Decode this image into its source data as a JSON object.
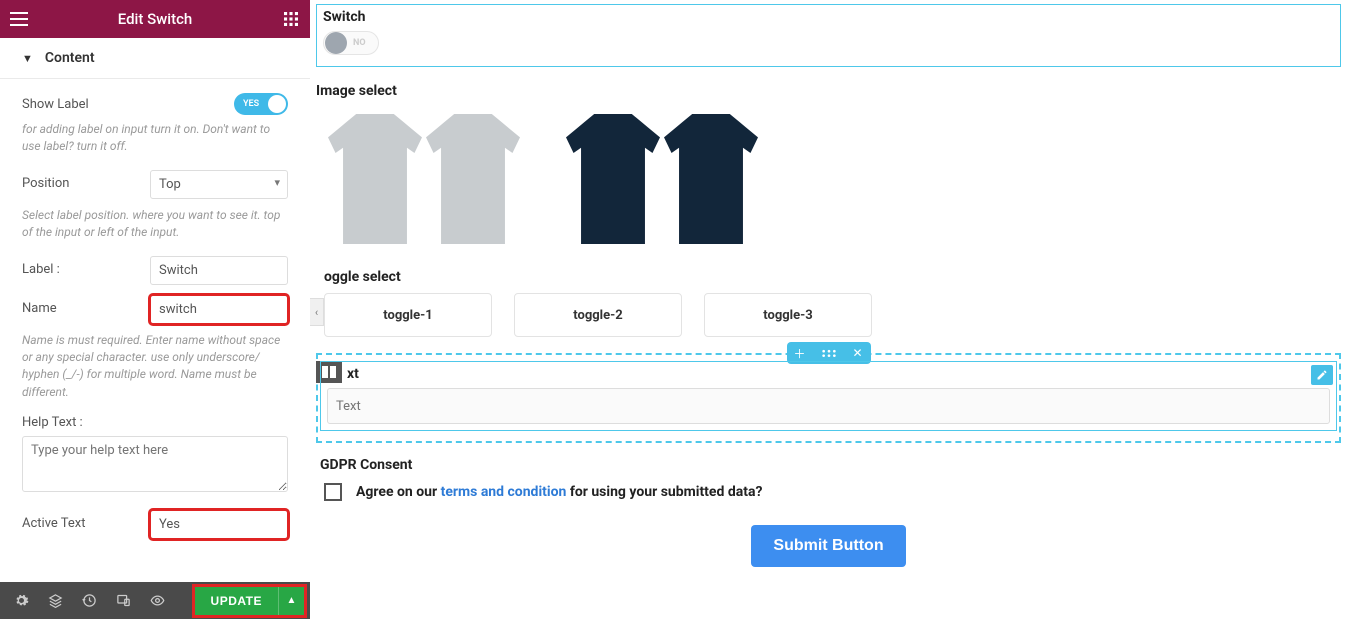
{
  "sidebar": {
    "title": "Edit Switch",
    "accordion": {
      "title": "Content"
    },
    "show_label": {
      "label": "Show Label",
      "toggle_text": "YES",
      "help": "for adding label on input turn it on. Don't want to use label? turn it off."
    },
    "position": {
      "label": "Position",
      "value": "Top",
      "help": "Select label position. where you want to see it. top of the input or left of the input."
    },
    "label_field": {
      "label": "Label :",
      "value": "Switch"
    },
    "name_field": {
      "label": "Name",
      "value": "switch",
      "help": "Name is must required. Enter name without space or any special character. use only underscore/ hyphen (_/-) for multiple word. Name must be different."
    },
    "help_text": {
      "label": "Help Text :",
      "placeholder": "Type your help text here"
    },
    "active_text": {
      "label": "Active Text",
      "value": "Yes"
    },
    "footer": {
      "update": "UPDATE"
    }
  },
  "canvas": {
    "switch": {
      "label": "Switch",
      "state_text": "NO"
    },
    "image_select": {
      "label": "Image select"
    },
    "toggle_select": {
      "label": "oggle select",
      "items": [
        "toggle-1",
        "toggle-2",
        "toggle-3"
      ]
    },
    "text_block": {
      "label": "xt",
      "placeholder": "Text"
    },
    "gdpr": {
      "label": "GDPR Consent",
      "before": "Agree on our ",
      "link": "terms and condition",
      "after": " for using your submitted data?"
    },
    "submit": {
      "label": "Submit Button"
    }
  }
}
